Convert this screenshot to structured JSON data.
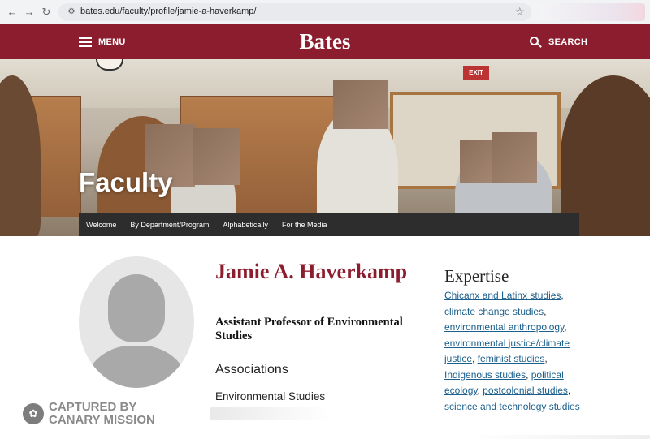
{
  "browser": {
    "url": "bates.edu/faculty/profile/jamie-a-haverkamp/"
  },
  "header": {
    "menu_label": "MENU",
    "logo": "Bates",
    "search_label": "SEARCH"
  },
  "hero": {
    "title": "Faculty",
    "exit_sign": "EXIT"
  },
  "subnav": {
    "items": [
      "Welcome",
      "By Department/Program",
      "Alphabetically",
      "For the Media"
    ]
  },
  "profile": {
    "name": "Jamie A. Haverkamp",
    "title": "Assistant Professor of Environmental Studies",
    "associations_heading": "Associations",
    "associations": [
      "Environmental Studies"
    ]
  },
  "expertise": {
    "heading": "Expertise",
    "items": [
      "Chicanx and Latinx studies",
      "climate change studies",
      "environmental anthropology",
      "environmental justice/climate justice",
      "feminist studies",
      "Indigenous studies",
      "political ecology",
      "postcolonial studies",
      "science and technology studies"
    ]
  },
  "watermark": {
    "line1": "CAPTURED BY",
    "line2": "CANARY MISSION"
  },
  "colors": {
    "brand": "#8c1d2e",
    "link": "#1b5f8c",
    "subnav_bg": "#2d2d2d"
  }
}
